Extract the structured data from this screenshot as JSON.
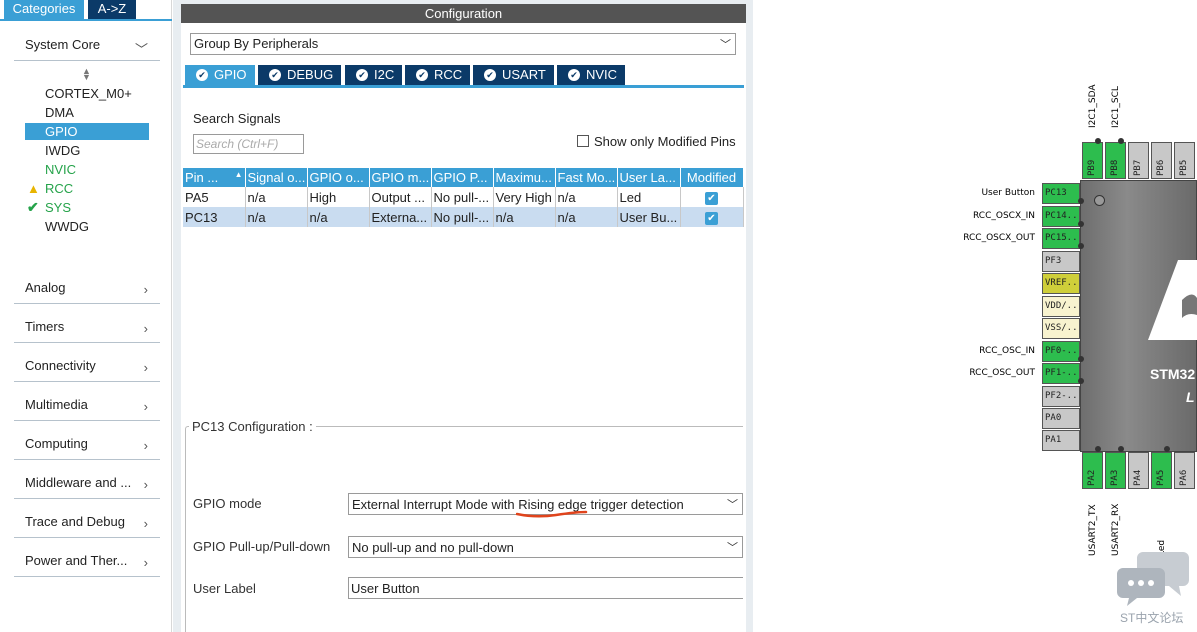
{
  "left_panel": {
    "tabs": [
      "Categories",
      "A->Z"
    ],
    "system_core": "System Core",
    "system_core_items": [
      "CORTEX_M0+",
      "DMA",
      "GPIO",
      "IWDG",
      "NVIC",
      "RCC",
      "SYS",
      "WWDG"
    ],
    "categories": [
      "Analog",
      "Timers",
      "Connectivity",
      "Multimedia",
      "Computing",
      "Middleware and ...",
      "Trace and Debug",
      "Power and Ther..."
    ]
  },
  "config": {
    "title": "Configuration",
    "group_by": "Group By Peripherals",
    "tabs": [
      "GPIO",
      "DEBUG",
      "I2C",
      "RCC",
      "USART",
      "NVIC"
    ],
    "search_label": "Search Signals",
    "search_placeholder": "Search (Ctrl+F)",
    "show_modified": "Show only Modified Pins",
    "table": {
      "headers": [
        "Pin ...",
        "Signal o...",
        "GPIO o...",
        "GPIO m...",
        "GPIO P...",
        "Maximu...",
        "Fast Mo...",
        "User La...",
        "Modified"
      ],
      "rows": [
        [
          "PA5",
          "n/a",
          "High",
          "Output ...",
          "No pull-...",
          "Very High",
          "n/a",
          "Led"
        ],
        [
          "PC13",
          "n/a",
          "n/a",
          "Externa...",
          "No pull-...",
          "n/a",
          "n/a",
          "User Bu..."
        ]
      ]
    },
    "pin_config": {
      "title": "PC13 Configuration :",
      "gpio_mode_label": "GPIO mode",
      "gpio_mode_value": "External Interrupt Mode with Rising edge trigger detection",
      "pull_label": "GPIO Pull-up/Pull-down",
      "pull_value": "No pull-up and no pull-down",
      "user_label_label": "User Label",
      "user_label_value": "User Button"
    }
  },
  "chip": {
    "left_pins": [
      {
        "name": "PC13",
        "signal": "User Button",
        "color": "#2dbd4e"
      },
      {
        "name": "PC14...",
        "signal": "RCC_OSCX_IN",
        "color": "#2dbd4e"
      },
      {
        "name": "PC15...",
        "signal": "RCC_OSCX_OUT",
        "color": "#2dbd4e"
      },
      {
        "name": "PF3",
        "signal": "",
        "color": "#c8c8c8"
      },
      {
        "name": "VREF...",
        "signal": "",
        "color": "#cfcf3a"
      },
      {
        "name": "VDD/...",
        "signal": "",
        "color": "#f8f3cf"
      },
      {
        "name": "VSS/...",
        "signal": "",
        "color": "#f8f3cf"
      },
      {
        "name": "PF0-...",
        "signal": "RCC_OSC_IN",
        "color": "#2dbd4e"
      },
      {
        "name": "PF1-...",
        "signal": "RCC_OSC_OUT",
        "color": "#2dbd4e"
      },
      {
        "name": "PF2-...",
        "signal": "",
        "color": "#c8c8c8"
      },
      {
        "name": "PA0",
        "signal": "",
        "color": "#c8c8c8"
      },
      {
        "name": "PA1",
        "signal": "",
        "color": "#c8c8c8"
      }
    ],
    "top_pins": [
      {
        "name": "PB9",
        "signal": "I2C1_SDA",
        "color": "#2dbd4e"
      },
      {
        "name": "PB8",
        "signal": "I2C1_SCL",
        "color": "#2dbd4e"
      },
      {
        "name": "PB7",
        "signal": "",
        "color": "#c8c8c8"
      },
      {
        "name": "PB6",
        "signal": "",
        "color": "#c8c8c8"
      },
      {
        "name": "PB5",
        "signal": "",
        "color": "#c8c8c8"
      }
    ],
    "bottom_pins": [
      {
        "name": "PA2",
        "signal": "USART2_TX",
        "color": "#2dbd4e"
      },
      {
        "name": "PA3",
        "signal": "USART2_RX",
        "color": "#2dbd4e"
      },
      {
        "name": "PA4",
        "signal": "",
        "color": "#c8c8c8"
      },
      {
        "name": "PA5",
        "signal": "Led",
        "color": "#2dbd4e"
      },
      {
        "name": "PA6",
        "signal": "",
        "color": "#c8c8c8"
      }
    ],
    "chip_name": "STM32",
    "chip_sub": "L",
    "watermark": "ST中文论坛"
  }
}
